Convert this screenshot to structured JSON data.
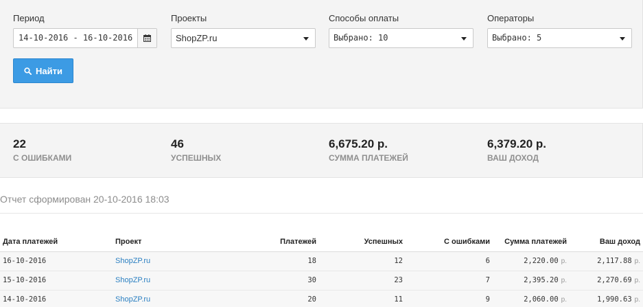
{
  "filters": {
    "period": {
      "label": "Период",
      "value": "14-10-2016 - 16-10-2016"
    },
    "projects": {
      "label": "Проекты",
      "value": "ShopZP.ru"
    },
    "payment_methods": {
      "label": "Способы оплаты",
      "value": "Выбрано: 10"
    },
    "operators": {
      "label": "Операторы",
      "value": "Выбрано: 5"
    },
    "search_button": "Найти"
  },
  "stats": [
    {
      "value": "22",
      "label": "С ОШИБКАМИ"
    },
    {
      "value": "46",
      "label": "УСПЕШНЫХ"
    },
    {
      "value": "6,675.20 р.",
      "label": "СУММА ПЛАТЕЖЕЙ"
    },
    {
      "value": "6,379.20 р.",
      "label": "ВАШ ДОХОД"
    }
  ],
  "report": {
    "generated": "Отчет сформирован 20-10-2016 18:03"
  },
  "table": {
    "headers": {
      "date": "Дата платежей",
      "project": "Проект",
      "payments": "Платежей",
      "success": "Успешных",
      "errors": "С ошибками",
      "sum": "Сумма платежей",
      "income": "Ваш доход"
    },
    "currency": "р.",
    "rows": [
      {
        "date": "16-10-2016",
        "project": "ShopZP.ru",
        "payments": "18",
        "success": "12",
        "errors": "6",
        "sum": "2,220.00",
        "income": "2,117.88"
      },
      {
        "date": "15-10-2016",
        "project": "ShopZP.ru",
        "payments": "30",
        "success": "23",
        "errors": "7",
        "sum": "2,395.20",
        "income": "2,270.69"
      },
      {
        "date": "14-10-2016",
        "project": "ShopZP.ru",
        "payments": "20",
        "success": "11",
        "errors": "9",
        "sum": "2,060.00",
        "income": "1,990.63"
      }
    ]
  },
  "colors": {
    "accent": "#3c9be4",
    "link": "#2a7fc1",
    "panel_bg": "#f4f4f4"
  }
}
